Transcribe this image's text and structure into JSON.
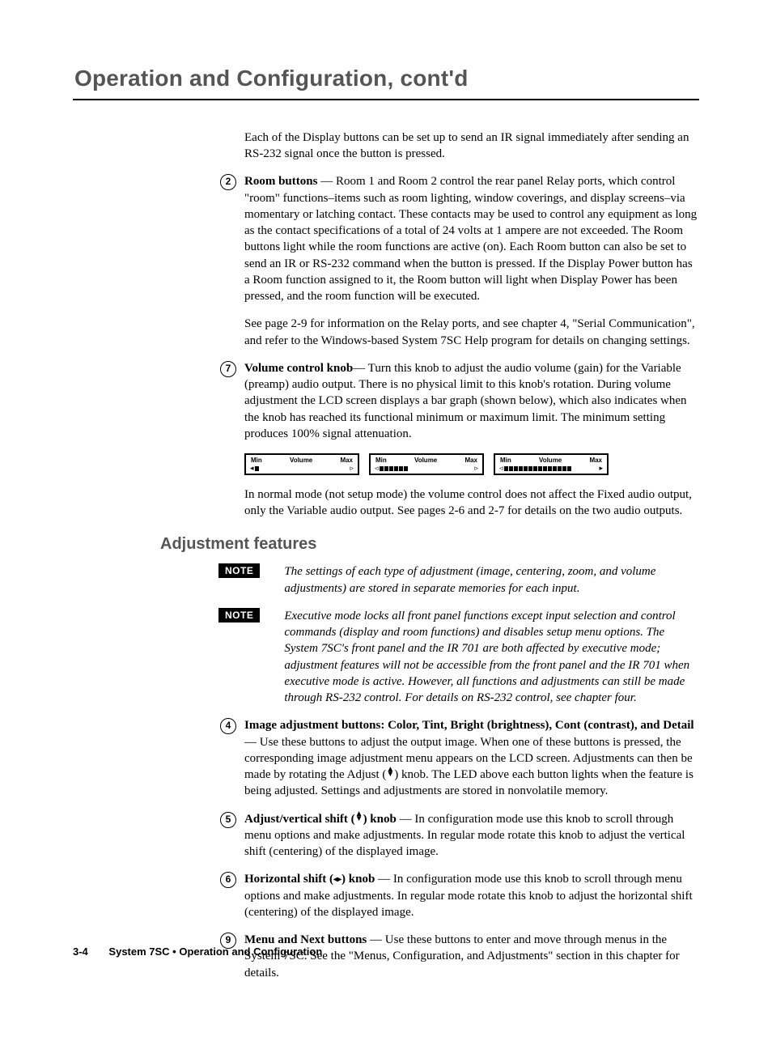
{
  "header": {
    "title": "Operation and Configuration, cont'd"
  },
  "intro": "Each of the Display buttons can be set up to send an IR signal immediately after sending an RS-232 signal once the button is pressed.",
  "item2": {
    "num": "2",
    "label": "Room buttons",
    "text": " —  Room 1 and Room 2 control the rear panel Relay ports, which control \"room\" functions–items such as room lighting, window coverings, and display screens–via momentary or latching contact.  These contacts may be used to control any equipment as long as the contact specifications of a total of 24 volts at 1 ampere are not exceeded.  The Room buttons light while the room functions are active (on).  Each Room button can also be set to send an IR or RS-232 command when the button is pressed.  If the Display Power button has a Room function assigned to it, the Room button will light when Display Power has been pressed, and the room function will be executed.",
    "see": "See page 2-9 for information on the Relay ports, and see chapter 4, \"Serial Communication\", and refer to the Windows-based System 7SC Help program for details on changing settings."
  },
  "item7": {
    "num": "7",
    "label": "Volume control knob",
    "text": "—  Turn this knob to adjust the audio volume (gain) for the Variable (preamp) audio output.  There is no physical limit to this knob's rotation.  During volume adjustment the LCD screen displays a bar graph (shown below), which also indicates when the knob has reached its functional minimum or maximum limit.  The minimum setting produces 100% signal attenuation."
  },
  "lcd": {
    "min": "Min",
    "vol": "Volume",
    "max": "Max"
  },
  "normalmode": "In normal mode (not setup mode) the volume control does not affect the Fixed audio output, only the Variable audio output.  See pages 2-6 and 2-7 for details on the two audio outputs.",
  "section": "Adjustment features",
  "note1": {
    "badge": "NOTE",
    "text": "The settings of each type of adjustment (image, centering, zoom, and volume adjustments) are stored in separate memories for each input."
  },
  "note2": {
    "badge": "NOTE",
    "text": "Executive mode locks all front panel functions except input selection and control commands (display and room functions) and disables setup menu options.  The System 7SC's front panel and the IR 701 are both affected by executive mode; adjustment features will not be accessible from the front panel and the IR 701 when executive mode is active.  However, all functions and adjustments can still be made through RS-232 control.  For details on RS-232 control, see chapter four."
  },
  "item4": {
    "num": "4",
    "label": "Image adjustment buttons: Color, Tint, Bright (brightness), Cont (contrast), and Detail",
    "text": " —  Use these buttons to adjust the output image.  When one of these buttons is pressed, the corresponding image adjustment menu appears on the LCD screen.  Adjustments can then be made by rotating the Adjust (",
    "text2": ") knob.  The LED above each button lights when the feature is being adjusted.  Settings and adjustments are stored in nonvolatile memory."
  },
  "item5": {
    "num": "5",
    "label": "Adjust/vertical shift (",
    "label2": ") knob",
    "text": " —  In configuration mode use this knob to scroll through menu options and make adjustments.  In regular mode rotate this knob to adjust the vertical shift (centering) of the displayed image."
  },
  "item6": {
    "num": "6",
    "label": "Horizontal shift (",
    "label2": ") knob",
    "text": " —  In configuration mode use this knob to scroll through menu options and make adjustments.  In regular mode rotate this knob to adjust the horizontal shift (centering) of the displayed image."
  },
  "item9": {
    "num": "9",
    "label": "Menu and Next buttons",
    "text": " —   Use these buttons to enter and move through menus in the System 7SC.  See the \"Menus, Configuration, and Adjustments\" section in this chapter for details."
  },
  "footer": {
    "page": "3-4",
    "product": "System 7SC • Operation and Configuration"
  }
}
